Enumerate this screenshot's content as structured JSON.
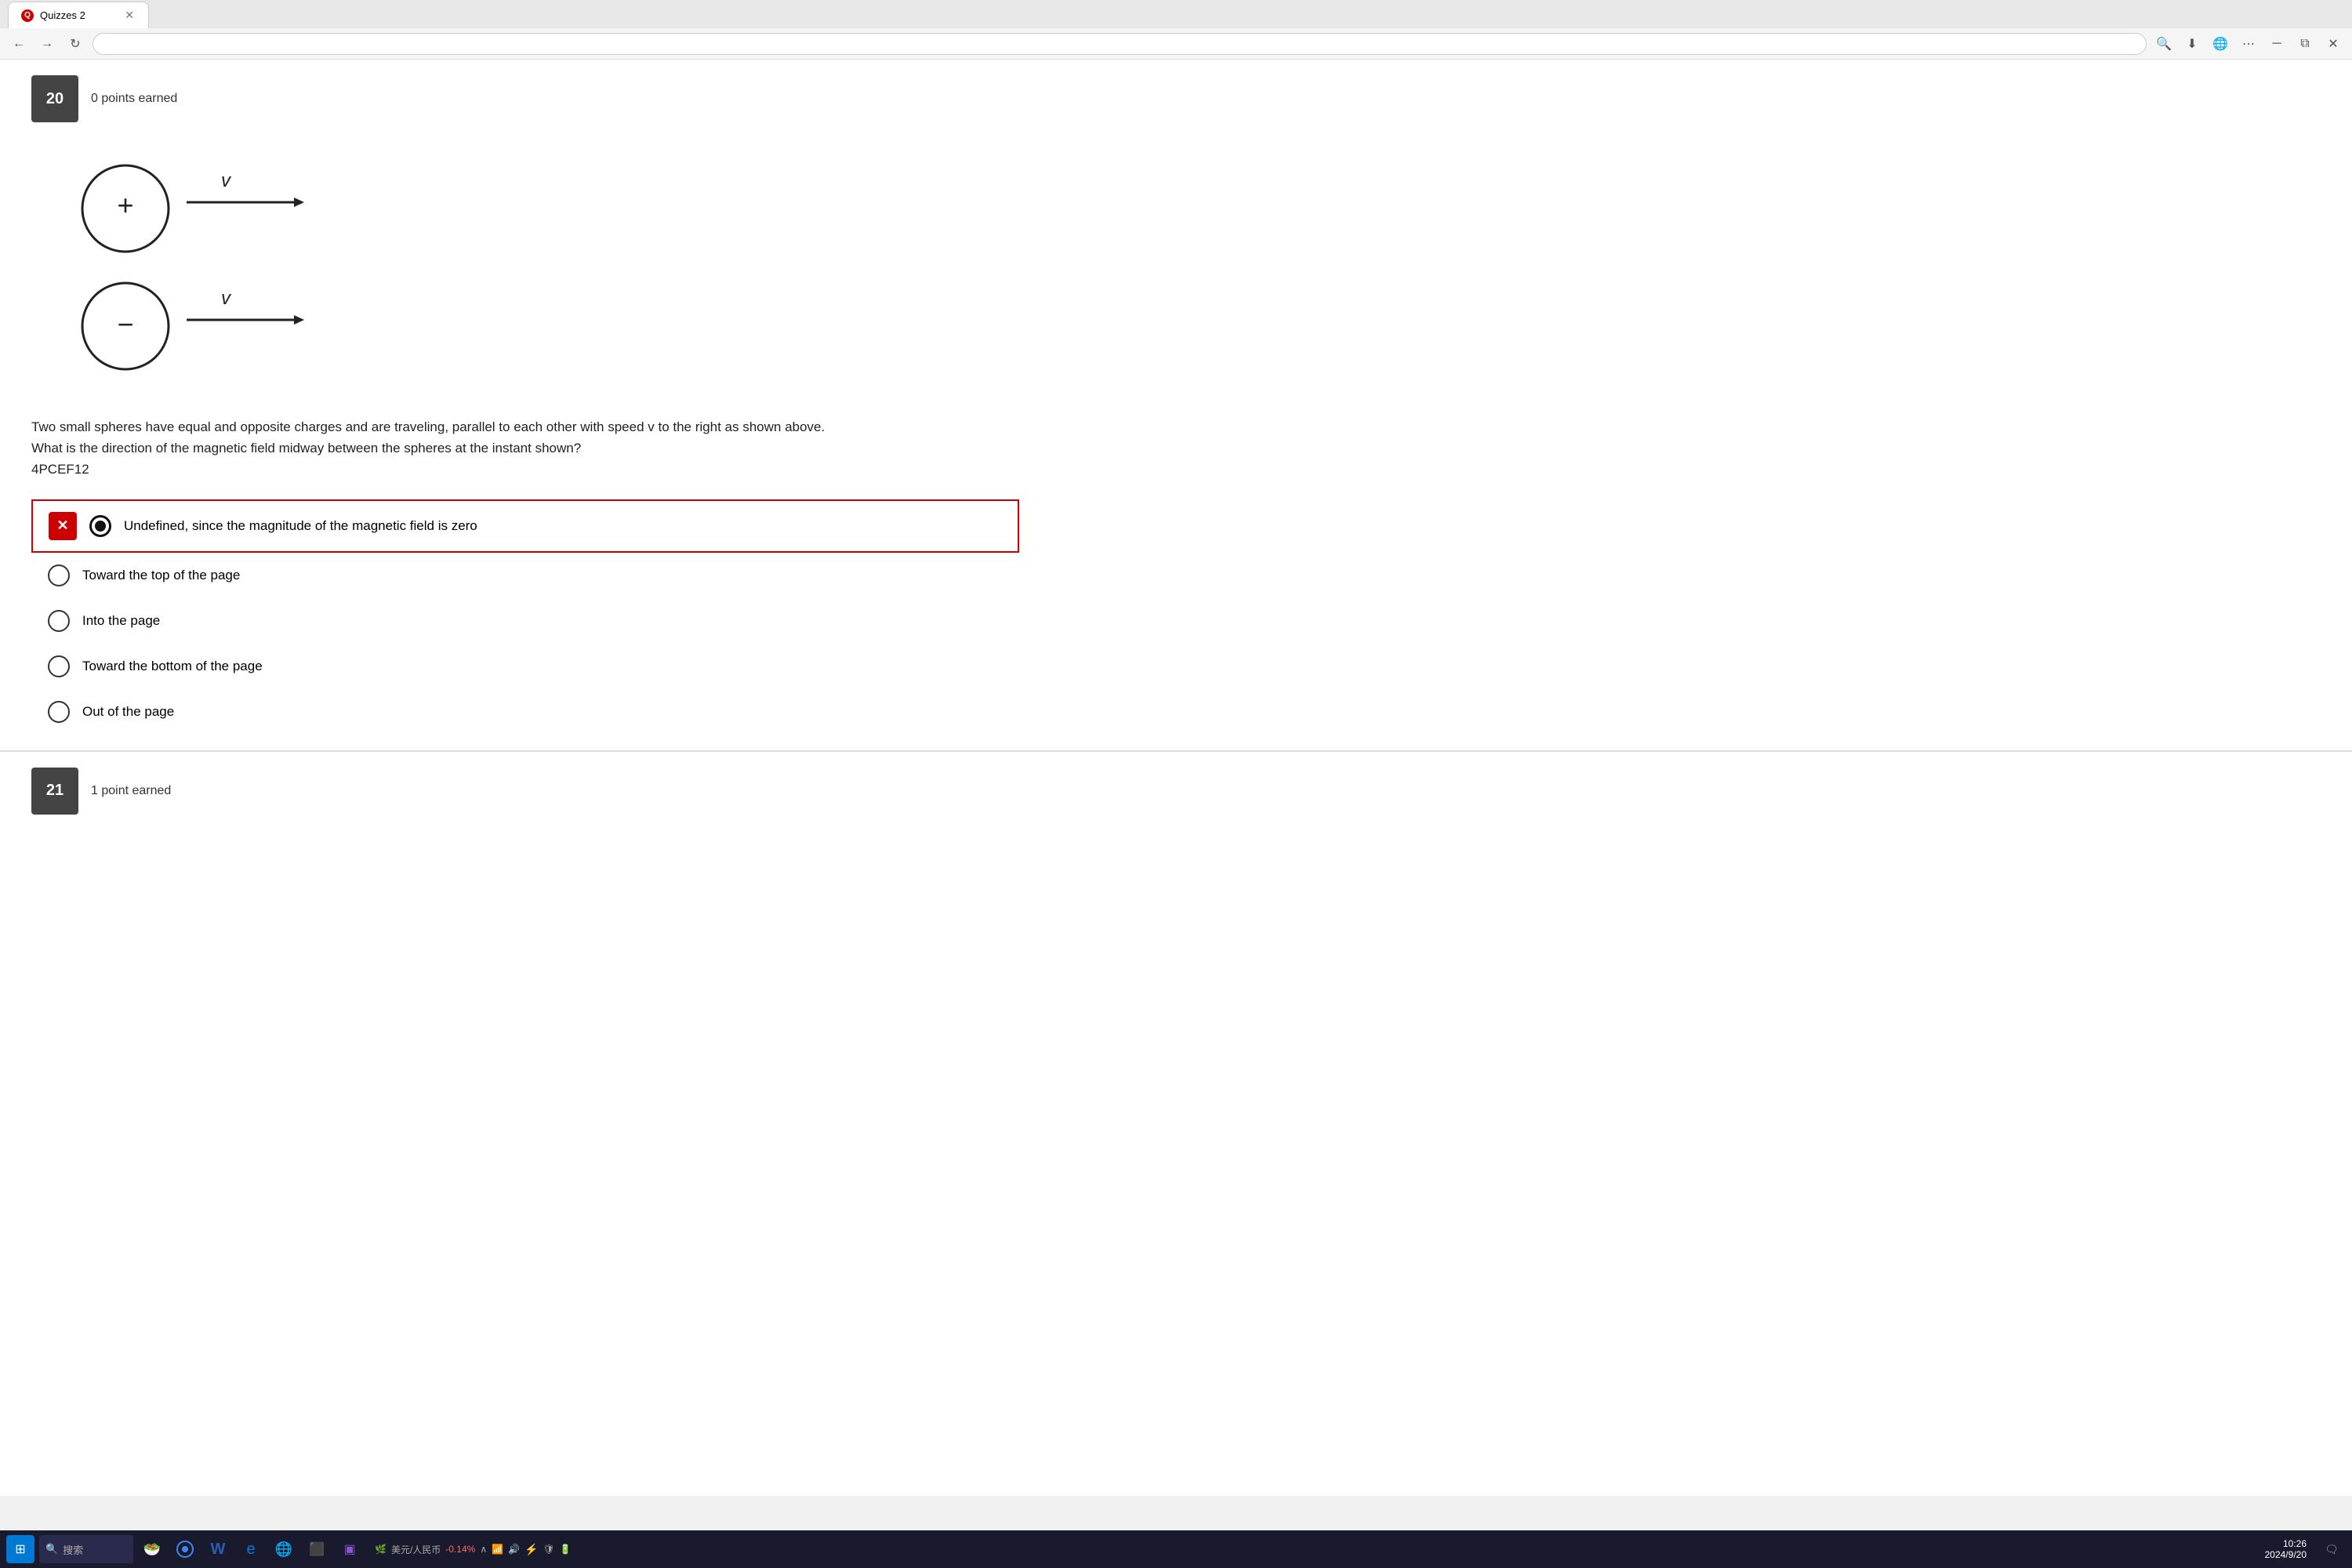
{
  "browser": {
    "tab_title": "Quizzes 2",
    "nav_back": "←",
    "nav_forward": "→",
    "nav_refresh": "↺",
    "search_icon": "🔍"
  },
  "question20": {
    "number": "20",
    "points_earned": "0 points earned",
    "question_text": "Two small spheres have equal and opposite charges and are traveling, parallel to each other with speed v to the right as shown above.",
    "question_text2": "What is the direction of the magnetic field midway between the spheres at the instant shown?",
    "question_code": "4PCEF12",
    "options": [
      {
        "id": "opt1",
        "label": "Undefined, since the magnitude of the magnetic field is zero",
        "selected": true,
        "wrong": true
      },
      {
        "id": "opt2",
        "label": "Toward the top of the page",
        "selected": false,
        "wrong": false
      },
      {
        "id": "opt3",
        "label": "Into the page",
        "selected": false,
        "wrong": false
      },
      {
        "id": "opt4",
        "label": "Toward the bottom of the page",
        "selected": false,
        "wrong": false
      },
      {
        "id": "opt5",
        "label": "Out of the page",
        "selected": false,
        "wrong": false
      }
    ]
  },
  "question21": {
    "number": "21",
    "points_earned": "1 point earned"
  },
  "taskbar": {
    "time": "10:26",
    "date": "2024/9/20",
    "stock_label": "美元/人民币",
    "stock_value": "-0.14%",
    "search_placeholder": "搜索"
  }
}
